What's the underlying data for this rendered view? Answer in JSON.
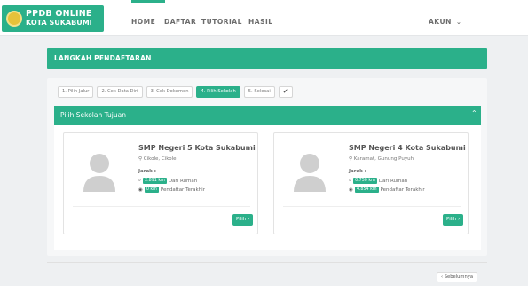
{
  "brand": {
    "line1": "PPDB ONLINE",
    "line2": "KOTA SUKABUMI",
    "logo_icon": "crest-logo-icon"
  },
  "nav": {
    "items": [
      "HOME",
      "DAFTAR",
      "TUTORIAL",
      "HASIL"
    ],
    "account": "AKUN",
    "account_icon": "chevron-down-icon"
  },
  "header": {
    "title": "LANGKAH PENDAFTARAN"
  },
  "steps": [
    "1. Pilih Jalur",
    "2. Cek Data Diri",
    "3. Cek Dokumen",
    "4. Pilih Sekolah",
    "5. Selesai",
    "✔"
  ],
  "active_step": "4. Pilih Sekolah",
  "section": {
    "title": "Pilih Sekolah Tujuan",
    "collapse_icon": "chevron-up-icon"
  },
  "cards": [
    {
      "name": "SMP Negeri 5 Kota Sukabumi",
      "address": "Cikole, Cikole",
      "jarak_label": "Jarak :",
      "dist_home": "2.891 km",
      "dist_home_label": "Dari Rumah",
      "dist_last": "0 km",
      "dist_last_label": "Pendaftar Terakhir",
      "button": "Pilih"
    },
    {
      "name": "SMP Negeri 4 Kota Sukabumi",
      "address": "Karamat, Gunung Puyuh",
      "jarak_label": "Jarak :",
      "dist_home": "0.750 km",
      "dist_home_label": "Dari Rumah",
      "dist_last": "4.854 km",
      "dist_last_label": "Pendaftar Terakhir",
      "button": "Pilih"
    }
  ],
  "prev_button": "Sebelumnya",
  "colors": {
    "accent": "#2bb08a",
    "background": "#eef0f2"
  }
}
